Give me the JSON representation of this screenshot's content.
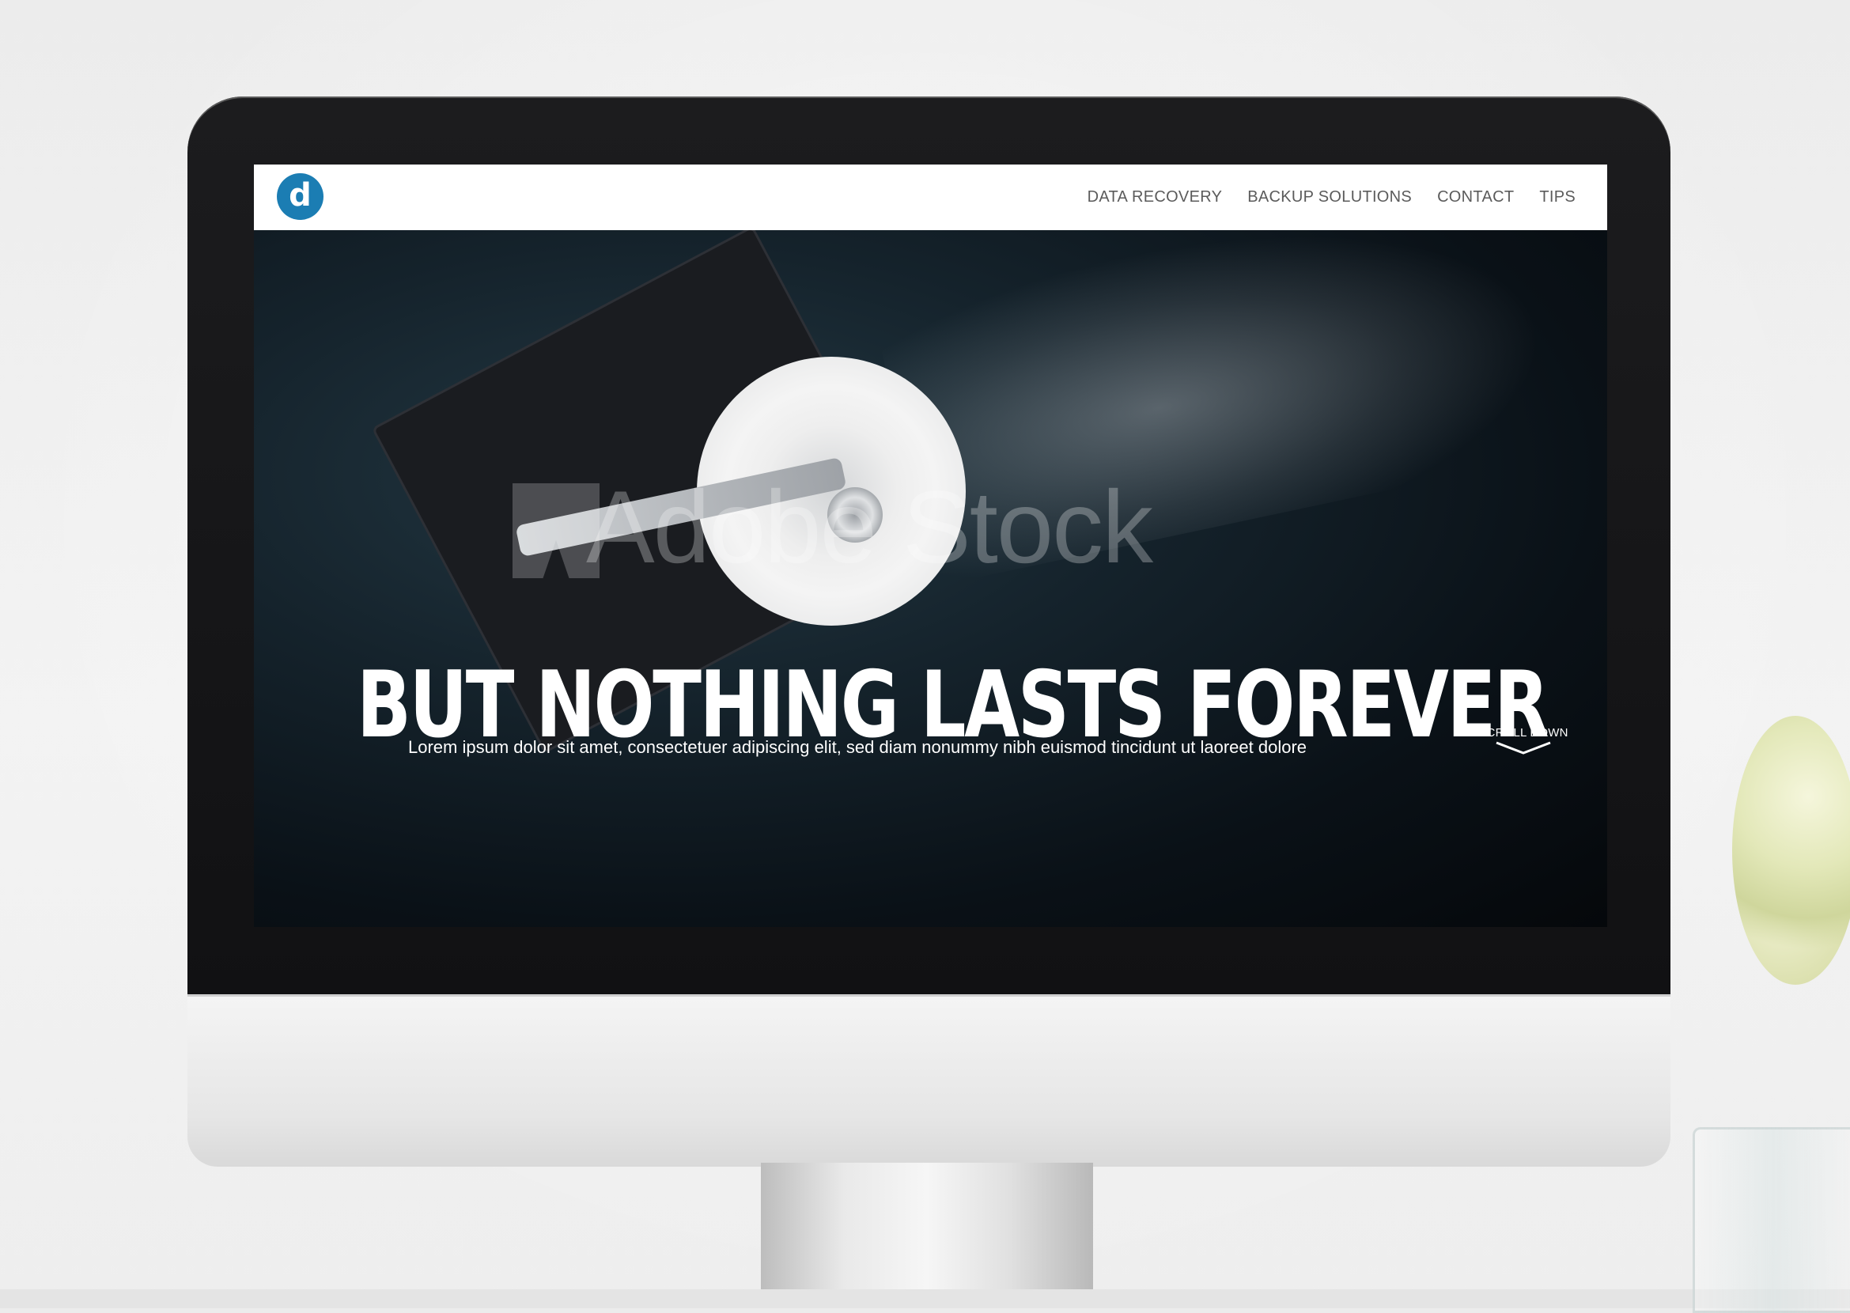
{
  "site": {
    "logo_letter": "d",
    "nav": [
      {
        "label": "DATA RECOVERY"
      },
      {
        "label": "BACKUP SOLUTIONS"
      },
      {
        "label": "CONTACT"
      },
      {
        "label": "TIPS"
      }
    ],
    "brand_color": "#1b7db3"
  },
  "hero": {
    "headline": "BUT NOTHING LASTS FOREVER",
    "subtext": "Lorem ipsum dolor sit amet, consectetuer adipiscing elit, sed diam nonummy nibh euismod tincidunt ut laoreet dolore",
    "scroll_label": "SCROLL DOWN",
    "watermark": "Adobe Stock",
    "icons": [
      "chevron-down-icon"
    ]
  }
}
